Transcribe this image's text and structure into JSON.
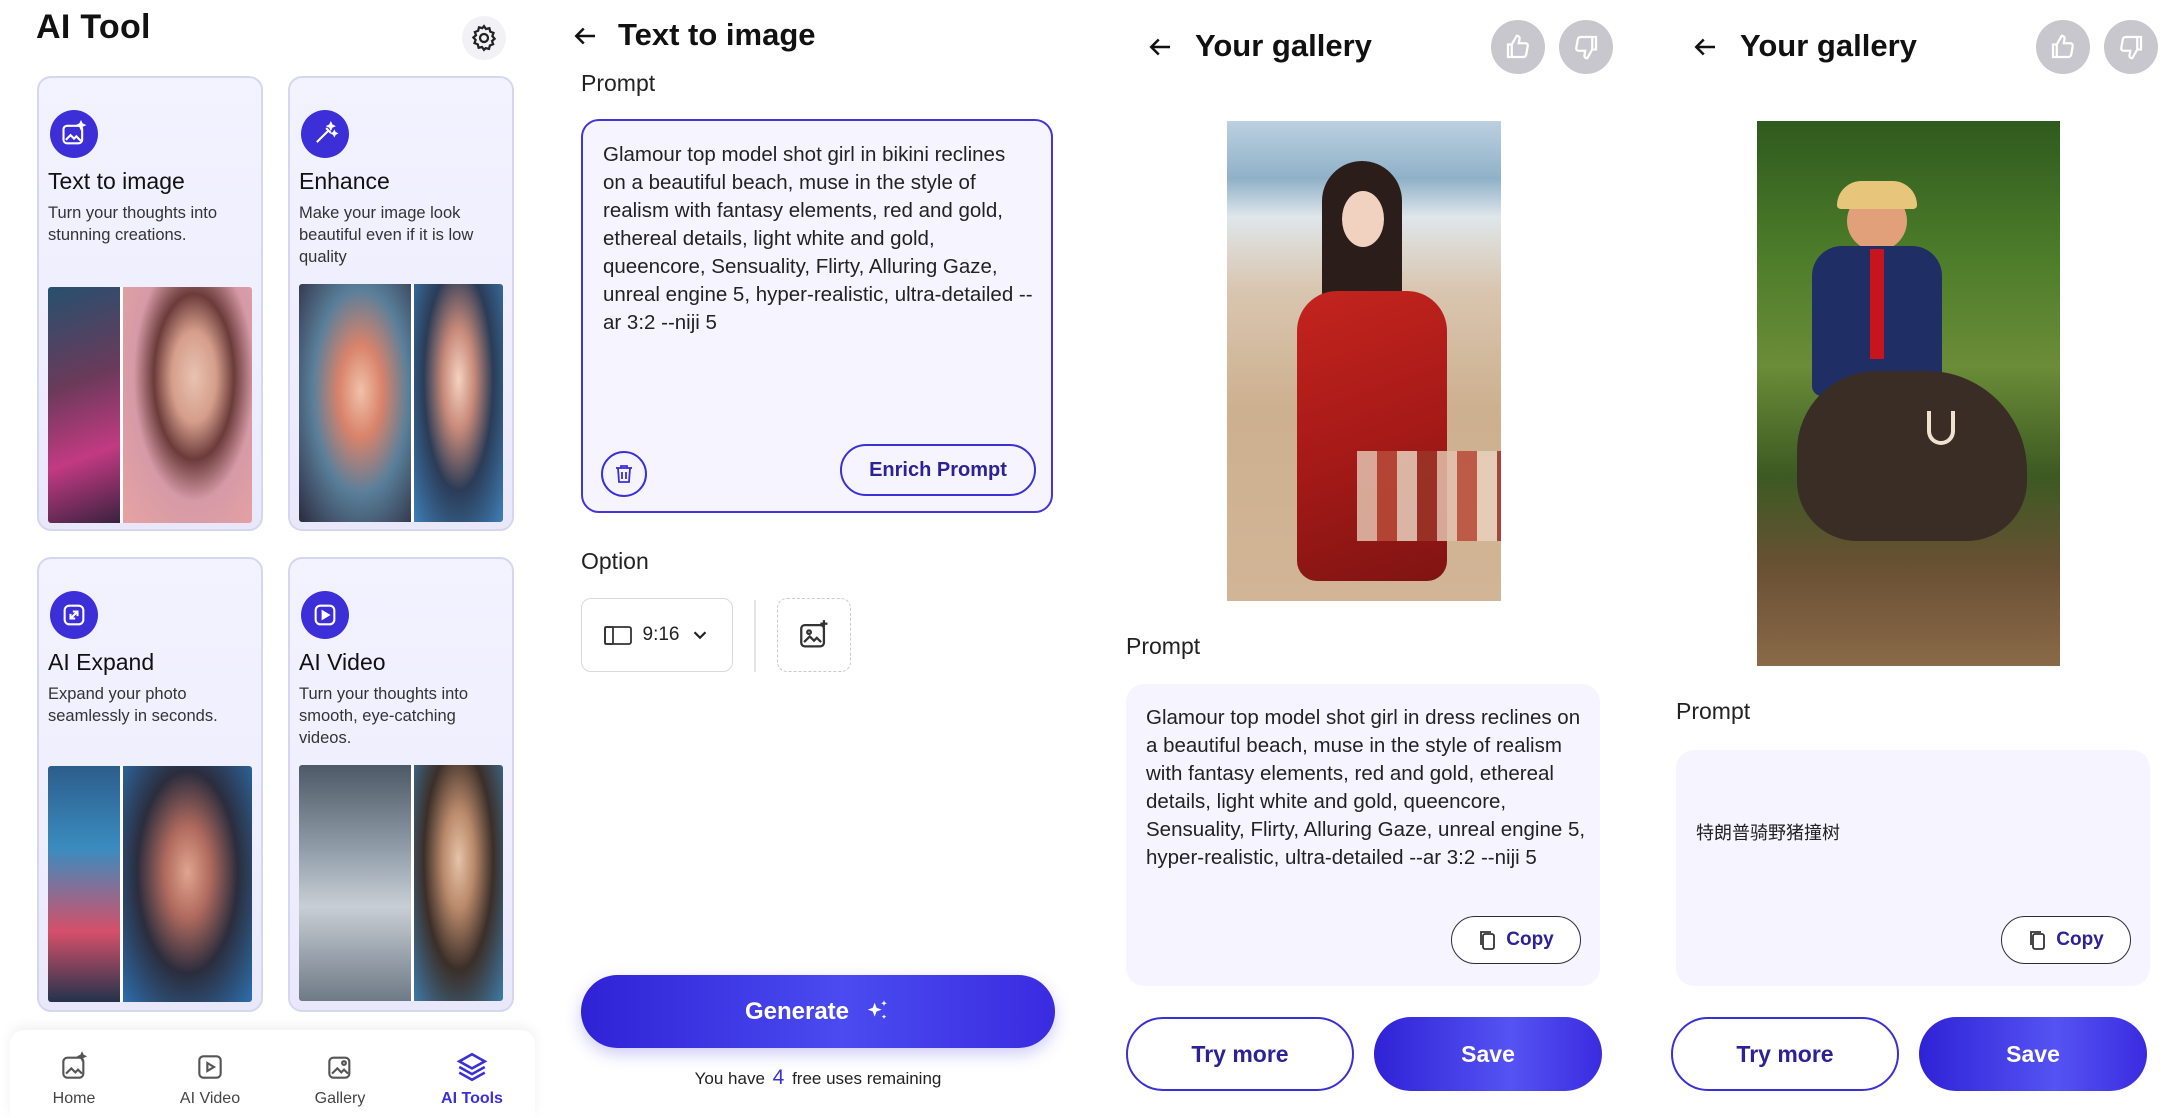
{
  "screen1": {
    "app_title": "AI Tool",
    "cards": [
      {
        "title": "Text to image",
        "desc": "Turn your thoughts into stunning creations."
      },
      {
        "title": "Enhance",
        "desc": "Make your image look beautiful even if it is low quality"
      },
      {
        "title": "AI Expand",
        "desc": "Expand your photo seamlessly in seconds."
      },
      {
        "title": "AI Video",
        "desc": "Turn your thoughts into smooth, eye-catching videos."
      }
    ],
    "nav": [
      {
        "label": "Home",
        "icon": "home-icon"
      },
      {
        "label": "AI Video",
        "icon": "video-icon"
      },
      {
        "label": "Gallery",
        "icon": "gallery-icon"
      },
      {
        "label": "AI Tools",
        "icon": "layers-icon",
        "active": true
      }
    ]
  },
  "screen2": {
    "title": "Text to image",
    "prompt_label": "Prompt",
    "prompt_text": "Glamour top model shot girl in bikini reclines on a beautiful beach, muse in the style of realism with fantasy elements, red and gold, ethereal details, light white and gold, queencore, Sensuality, Flirty, Alluring Gaze, unreal engine 5, hyper-realistic, ultra-detailed --ar 3:2 --niji 5",
    "enrich_label": "Enrich Prompt",
    "option_label": "Option",
    "ratio_value": "9:16",
    "generate_label": "Generate",
    "remaining_prefix": "You have",
    "remaining_count": "4",
    "remaining_suffix": "free uses remaining"
  },
  "screen3": {
    "title": "Your gallery",
    "prompt_label": "Prompt",
    "prompt_text": "Glamour top model shot girl in dress reclines on a beautiful beach, muse in the style of realism with fantasy elements, red and gold, ethereal details, light white and gold, queencore, Sensuality, Flirty, Alluring Gaze, unreal engine 5, hyper-realistic, ultra-detailed --ar 3:2 --niji 5",
    "copy_label": "Copy",
    "try_more_label": "Try more",
    "save_label": "Save"
  },
  "screen4": {
    "title": "Your gallery",
    "prompt_label": "Prompt",
    "prompt_text": "特朗普骑野猪撞树",
    "copy_label": "Copy",
    "try_more_label": "Try more",
    "save_label": "Save"
  },
  "colors": {
    "accent": "#3b2fd6",
    "accent_dark": "#2c2296",
    "card_bg": "#f1f0fe",
    "prompt_bg": "#f6f5ff",
    "thumb_bg": "#c7c7cd"
  }
}
